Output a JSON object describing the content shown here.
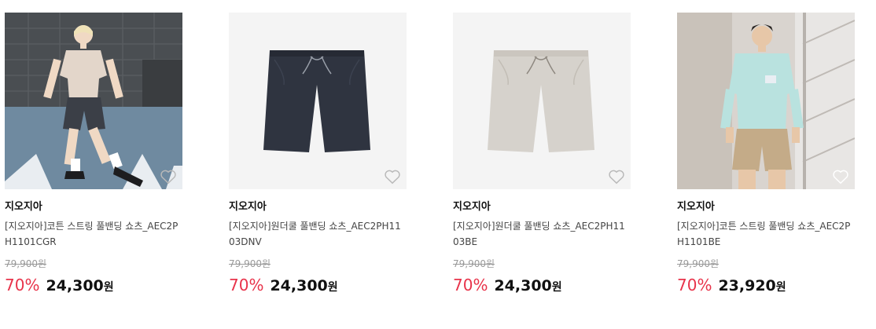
{
  "products": [
    {
      "brand": "지오지아",
      "name": "[지오지아]코튼 스트링 풀밴딩 쇼츠_AEC2PH1101CGR",
      "original_price": "79,900원",
      "discount": "70%",
      "price": "24,300",
      "currency": "원",
      "image": "model-woman-charcoal-shorts",
      "shorts_color": "#3b3f47"
    },
    {
      "brand": "지오지아",
      "name": "[지오지아]원더쿨 풀밴딩 쇼츠_AEC2PH1103DNV",
      "original_price": "79,900원",
      "discount": "70%",
      "price": "24,300",
      "currency": "원",
      "image": "navy-shorts-flatlay",
      "shorts_color": "#2f3440"
    },
    {
      "brand": "지오지아",
      "name": "[지오지아]원더쿨 풀밴딩 쇼츠_AEC2PH1103BE",
      "original_price": "79,900원",
      "discount": "70%",
      "price": "24,300",
      "currency": "원",
      "image": "beige-shorts-flatlay",
      "shorts_color": "#d6d2cc"
    },
    {
      "brand": "지오지아",
      "name": "[지오지아]코튼 스트링 풀밴딩 쇼츠_AEC2PH1101BE",
      "original_price": "79,900원",
      "discount": "70%",
      "price": "23,920",
      "currency": "원",
      "image": "model-man-beige-shorts",
      "shorts_color": "#c4ab88"
    }
  ],
  "colors": {
    "discount": "#e8334a",
    "original_price": "#999999"
  },
  "icons": {
    "wishlist": "heart-outline-icon"
  }
}
